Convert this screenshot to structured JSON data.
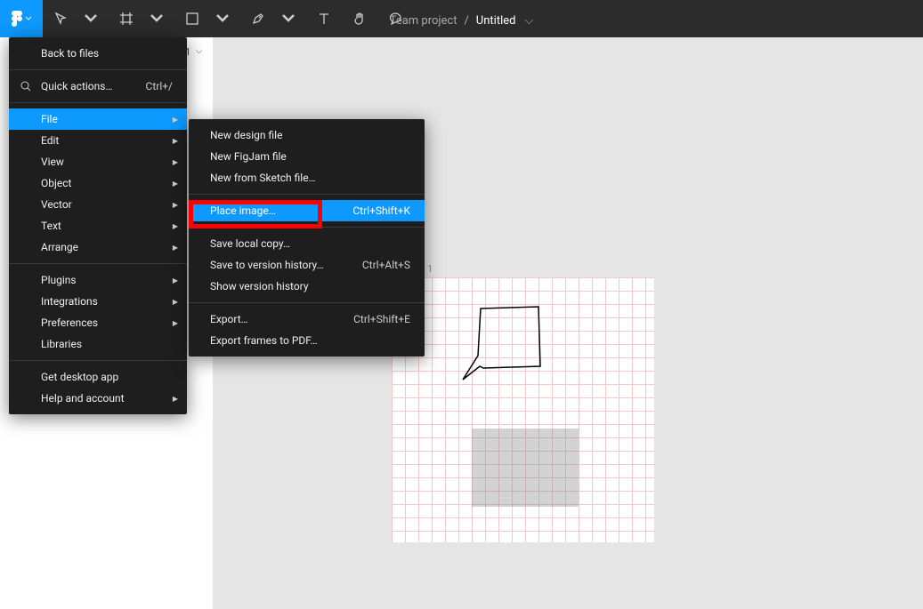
{
  "header": {
    "team": "Team project",
    "separator": "/",
    "file": "Untitled"
  },
  "leftpanel": {
    "page_indicator": "1"
  },
  "canvas": {
    "artboard_label": "1"
  },
  "main_menu": {
    "back": "Back to files",
    "quick_actions": {
      "label": "Quick actions…",
      "shortcut": "Ctrl+/"
    },
    "file": "File",
    "edit": "Edit",
    "view": "View",
    "object": "Object",
    "vector": "Vector",
    "text": "Text",
    "arrange": "Arrange",
    "plugins": "Plugins",
    "integrations": "Integrations",
    "preferences": "Preferences",
    "libraries": "Libraries",
    "desktop": "Get desktop app",
    "help": "Help and account"
  },
  "file_menu": {
    "new_design": "New design file",
    "new_figjam": "New FigJam file",
    "new_sketch": "New from Sketch file…",
    "place_image": {
      "label": "Place image…",
      "shortcut": "Ctrl+Shift+K"
    },
    "save_local": "Save local copy…",
    "save_version": {
      "label": "Save to version history…",
      "shortcut": "Ctrl+Alt+S"
    },
    "show_history": "Show version history",
    "export": {
      "label": "Export…",
      "shortcut": "Ctrl+Shift+E"
    },
    "export_pdf": "Export frames to PDF…"
  },
  "toolbar_icons": {
    "logo": "figma-logo-icon",
    "move": "move-tool-icon",
    "frame": "frame-tool-icon",
    "shape": "rectangle-tool-icon",
    "pen": "pen-tool-icon",
    "text": "text-tool-icon",
    "hand": "hand-tool-icon",
    "comment": "comment-tool-icon"
  },
  "colors": {
    "accent": "#0d99ff",
    "menu_bg": "#1e1e1e",
    "toolbar_bg": "#2c2c2c",
    "highlight_red": "#ff0000"
  }
}
